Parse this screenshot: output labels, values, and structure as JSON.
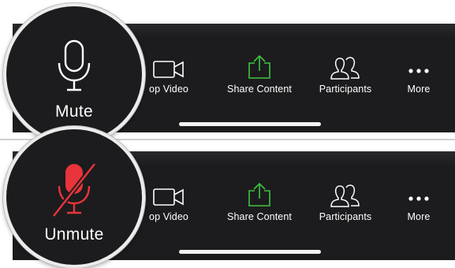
{
  "colors": {
    "toolbar_bg": "#1c1c1e",
    "icon_white": "#ffffff",
    "share_green": "#3ec43e",
    "muted_red": "#e8343a"
  },
  "panels": [
    {
      "state": "unmuted",
      "audio_button": {
        "label": "Mute",
        "icon": "microphone-icon"
      },
      "toolbar": {
        "items": [
          {
            "label": "op Video",
            "icon": "video-camera-icon"
          },
          {
            "label": "Share Content",
            "icon": "share-upload-icon"
          },
          {
            "label": "Participants",
            "icon": "participants-icon"
          },
          {
            "label": "More",
            "icon": "more-dots-icon"
          }
        ]
      }
    },
    {
      "state": "muted",
      "audio_button": {
        "label": "Unmute",
        "icon": "microphone-muted-icon"
      },
      "toolbar": {
        "items": [
          {
            "label": "op Video",
            "icon": "video-camera-icon"
          },
          {
            "label": "Share Content",
            "icon": "share-upload-icon"
          },
          {
            "label": "Participants",
            "icon": "participants-icon"
          },
          {
            "label": "More",
            "icon": "more-dots-icon"
          }
        ]
      }
    }
  ]
}
